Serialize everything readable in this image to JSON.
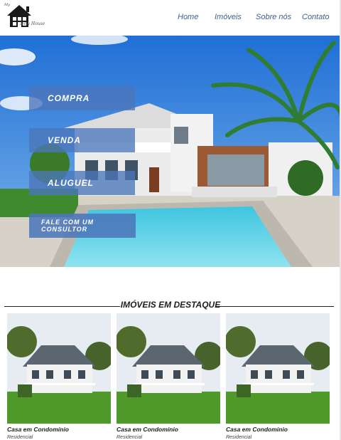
{
  "nav": {
    "logo_top": "My",
    "logo_bottom": "New House",
    "items": [
      "Home",
      "Imóveis",
      "Sobre nós",
      "Contato"
    ]
  },
  "hero": {
    "buttons": [
      "COMPRA",
      "VENDA",
      "ALUGUEL"
    ],
    "consult": "FALE COM UM CONSULTOR"
  },
  "featured": {
    "title": "IMÓVEIS EM DESTAQUE",
    "cards": [
      {
        "title": "Casa em Condomínio",
        "type": "Residencial"
      },
      {
        "title": "Casa em Condomínio",
        "type": "Residencial"
      },
      {
        "title": "Casa em Condomínio",
        "type": "Residencial"
      }
    ]
  },
  "colors": {
    "accent": "#4c76ba",
    "nav_text": "#3f5f8c"
  }
}
